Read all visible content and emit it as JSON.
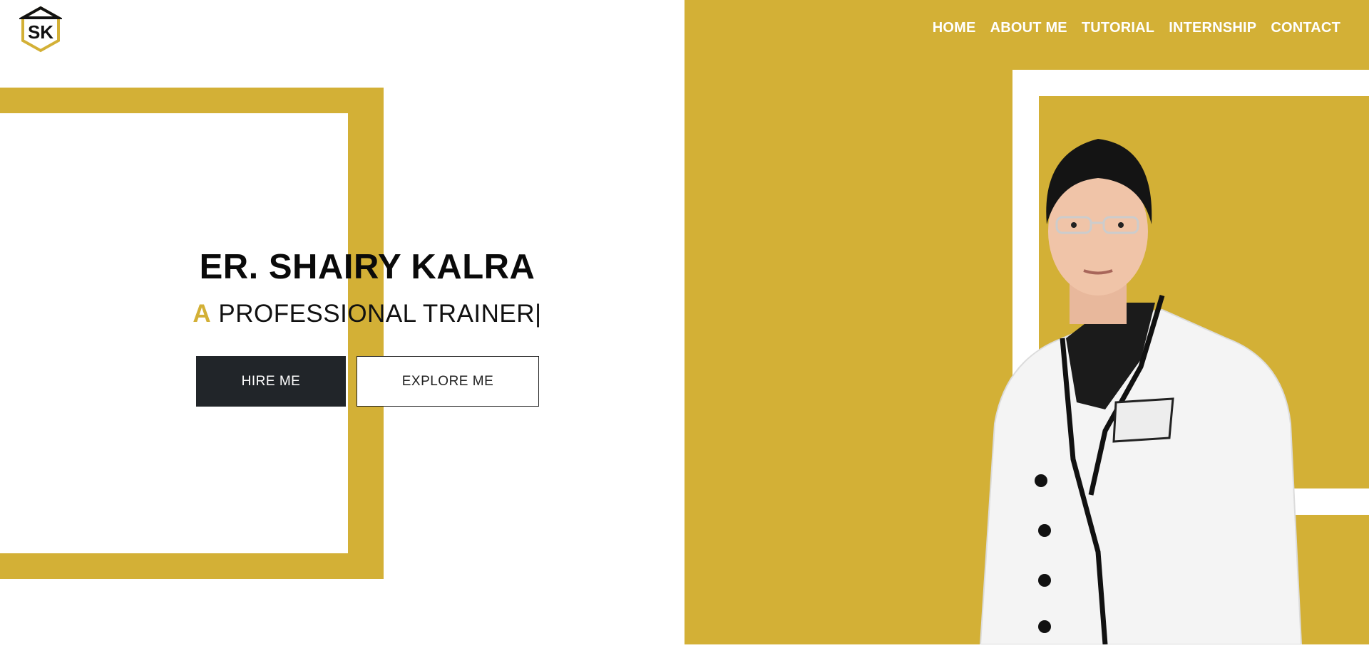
{
  "brand": {
    "logo_text": "SK",
    "accent_color": "#d3b036"
  },
  "nav": {
    "items": [
      {
        "label": "HOME"
      },
      {
        "label": "ABOUT ME"
      },
      {
        "label": "TUTORIAL"
      },
      {
        "label": "INTERNSHIP"
      },
      {
        "label": "CONTACT"
      }
    ]
  },
  "hero": {
    "name": "ER. SHAIRY KALRA",
    "subtitle_prefix": "A",
    "subtitle_text": "PROFESSIONAL TRAINER|",
    "hire_button": "HIRE ME",
    "explore_button": "EXPLORE ME"
  }
}
